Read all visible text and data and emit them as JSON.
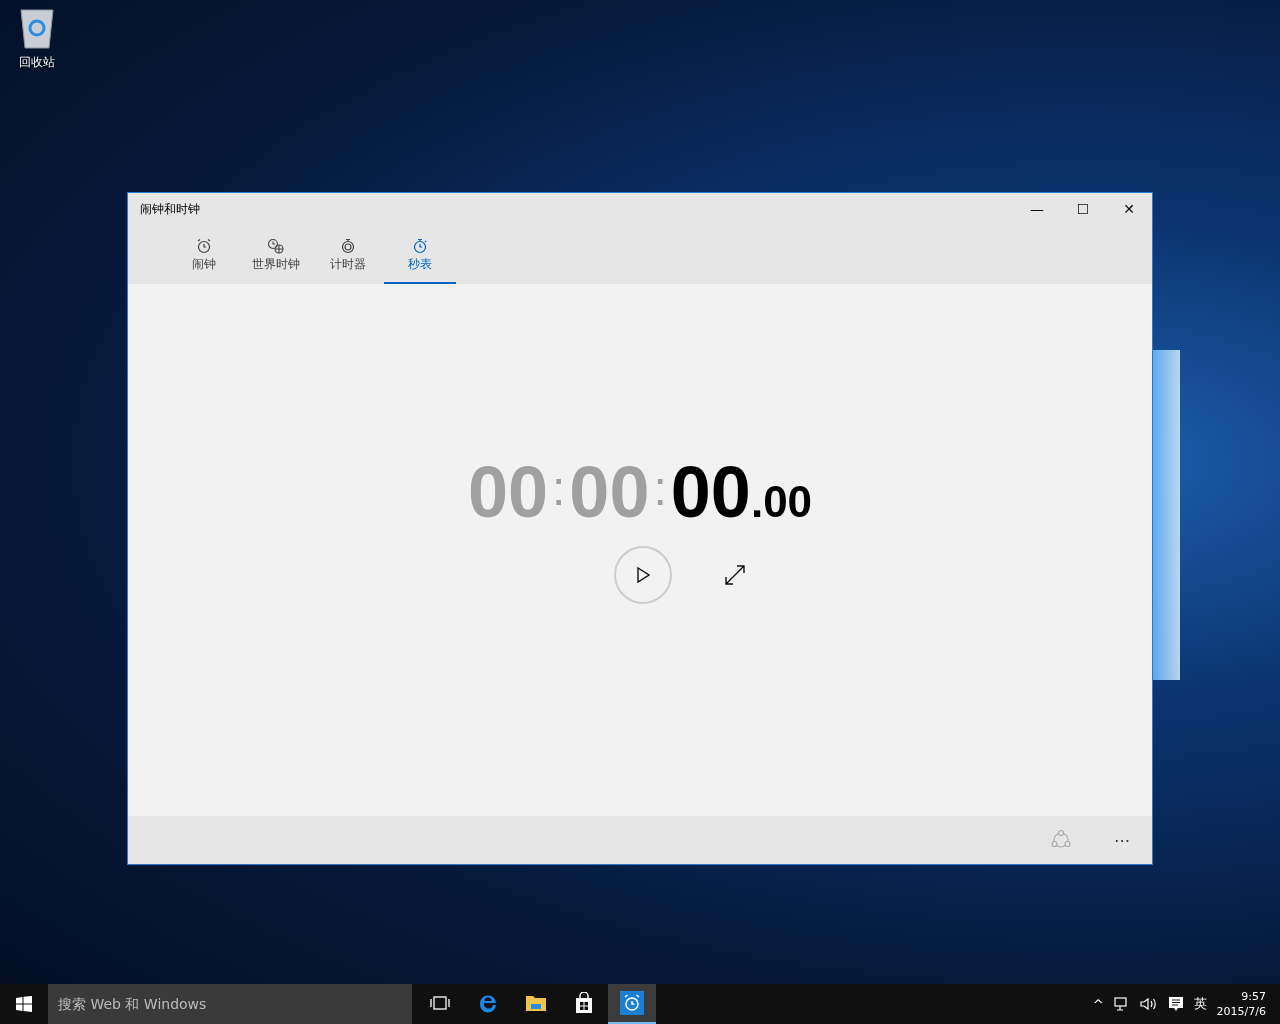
{
  "desktop": {
    "icons": [
      {
        "label": "回收站"
      }
    ]
  },
  "window": {
    "title": "闹钟和时钟",
    "controls": [
      "—",
      "☐",
      "✕"
    ]
  },
  "tabs": [
    {
      "label": "闹钟",
      "selected": false
    },
    {
      "label": "世界时钟",
      "selected": false
    },
    {
      "label": "计时器",
      "selected": false
    },
    {
      "label": "秒表",
      "selected": true
    }
  ],
  "stopwatch": {
    "parts": [
      {
        "kind": "digits",
        "text": "00",
        "active": false
      },
      {
        "kind": "separator",
        "text": ":",
        "active": false
      },
      {
        "kind": "digits",
        "text": "00",
        "active": false
      },
      {
        "kind": "separator",
        "text": ":",
        "active": false
      },
      {
        "kind": "digits",
        "text": "00",
        "active": true
      },
      {
        "kind": "small",
        "text": ".",
        "active": true
      },
      {
        "kind": "small",
        "text": "00",
        "active": true
      }
    ]
  },
  "command_bar": {
    "more": "⋯"
  },
  "taskbar": {
    "search": {
      "placeholder": "搜索 Web 和 Windows"
    },
    "apps": [
      {
        "selected": false
      },
      {
        "selected": false
      },
      {
        "selected": false
      },
      {
        "selected": false
      },
      {
        "selected": true
      }
    ],
    "tray": {
      "expand": "^",
      "language": "英",
      "time": "9:57",
      "date": "2015/7/6"
    }
  }
}
